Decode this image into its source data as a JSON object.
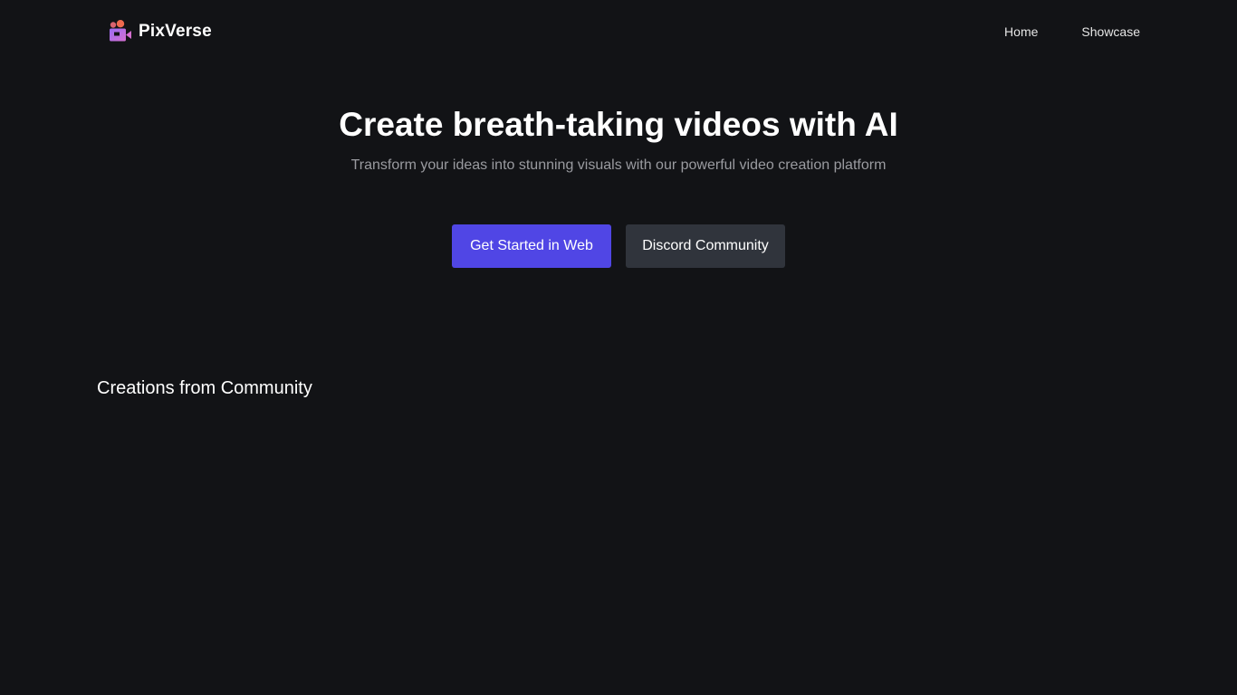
{
  "brand": {
    "name": "PixVerse",
    "logo_icon": "camera-logo-icon"
  },
  "nav": {
    "items": [
      {
        "label": "Home"
      },
      {
        "label": "Showcase"
      }
    ]
  },
  "hero": {
    "title": "Create breath-taking videos with AI",
    "subtitle": "Transform your ideas into stunning visuals with our powerful video creation platform",
    "primary_cta": "Get Started in Web",
    "secondary_cta": "Discord Community"
  },
  "community": {
    "title": "Creations from Community"
  },
  "colors": {
    "background": "#121316",
    "primary_button": "#5046e5",
    "secondary_button": "#30343c",
    "subtitle_text": "#9a9ba0"
  }
}
